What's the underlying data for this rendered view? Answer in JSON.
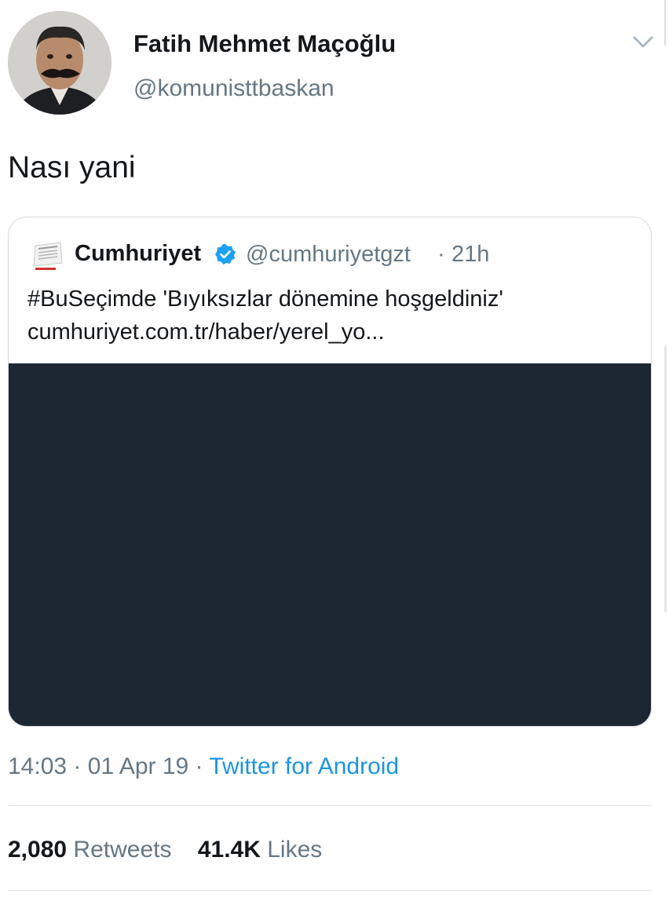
{
  "author": {
    "name": "Fatih Mehmet Maçoğlu",
    "handle": "@komunisttbaskan",
    "avatar_icon": "profile-photo"
  },
  "tweet": {
    "text": "Nası yani"
  },
  "quoted_tweet": {
    "name": "Cumhuriyet",
    "verified": true,
    "handle": "@cumhuriyetgzt",
    "separator": "·",
    "time": "21h",
    "text": "#BuSeçimde 'Bıyıksızlar dönemine hoşgeldiniz'",
    "link": "cumhuriyet.com.tr/haber/yerel_yo..."
  },
  "meta": {
    "time": "14:03",
    "sep1": "·",
    "date": "01 Apr 19",
    "sep2": "·",
    "source": "Twitter for Android"
  },
  "stats": {
    "retweets_count": "2,080",
    "retweets_label": "Retweets",
    "likes_count": "41.4K",
    "likes_label": "Likes"
  },
  "colors": {
    "accent": "#1b95e0",
    "secondary_text": "#657786",
    "media_bg": "#1c2733",
    "verified": "#1da1f2"
  }
}
